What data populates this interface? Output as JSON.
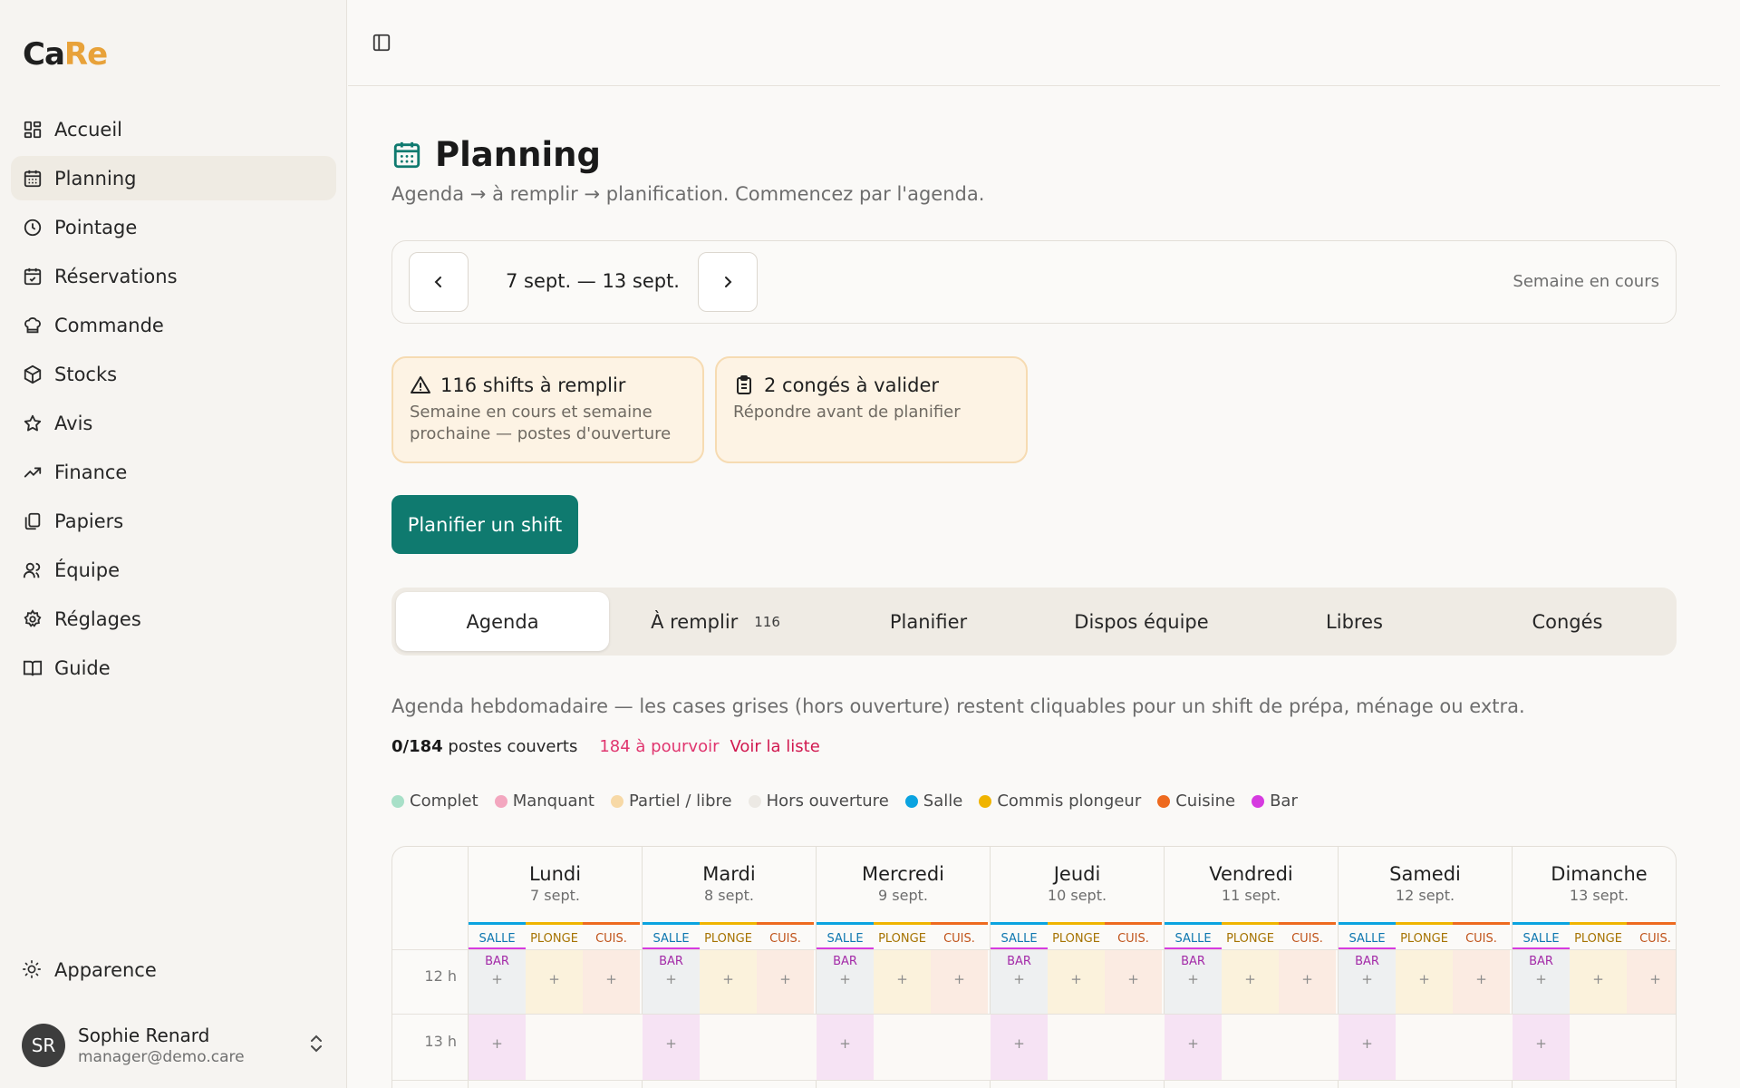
{
  "app": {
    "logo_ca": "Ca",
    "logo_re": "Re"
  },
  "sidebar": {
    "items": [
      {
        "label": "Accueil",
        "icon": "dashboard-icon"
      },
      {
        "label": "Planning",
        "icon": "calendar-icon",
        "active": true
      },
      {
        "label": "Pointage",
        "icon": "clock-icon"
      },
      {
        "label": "Réservations",
        "icon": "calendar-check-icon"
      },
      {
        "label": "Commande",
        "icon": "chef-hat-icon"
      },
      {
        "label": "Stocks",
        "icon": "package-icon"
      },
      {
        "label": "Avis",
        "icon": "star-icon"
      },
      {
        "label": "Finance",
        "icon": "trend-icon"
      },
      {
        "label": "Papiers",
        "icon": "documents-icon"
      },
      {
        "label": "Équipe",
        "icon": "users-icon"
      },
      {
        "label": "Réglages",
        "icon": "gear-icon"
      },
      {
        "label": "Guide",
        "icon": "book-icon"
      }
    ],
    "appearance": "Apparence",
    "user": {
      "initials": "SR",
      "name": "Sophie Renard",
      "email": "manager@demo.care"
    }
  },
  "page": {
    "title": "Planning",
    "subtitle": "Agenda → à remplir → planification. Commencez par l'agenda."
  },
  "week": {
    "range": "7 sept. — 13 sept.",
    "current": "Semaine en cours"
  },
  "alerts": [
    {
      "title": "116 shifts à remplir",
      "sub": "Semaine en cours et semaine prochaine — postes d'ouverture",
      "icon": "warning-icon"
    },
    {
      "title": "2 congés à valider",
      "sub": "Répondre avant de planifier",
      "icon": "clipboard-icon"
    }
  ],
  "plan_button": "Planifier un shift",
  "tabs": [
    {
      "label": "Agenda",
      "active": true
    },
    {
      "label": "À remplir",
      "count": "116"
    },
    {
      "label": "Planifier"
    },
    {
      "label": "Dispos équipe"
    },
    {
      "label": "Libres"
    },
    {
      "label": "Congés"
    }
  ],
  "agenda": {
    "description": "Agenda hebdomadaire — les cases grises (hors ouverture) restent cliquables pour un shift de prépa, ménage ou extra.",
    "covered_value": "0/184",
    "covered_label": "postes couverts",
    "open": "184 à pourvoir",
    "link": "Voir la liste"
  },
  "legend": [
    {
      "label": "Complet",
      "color": "#a8e0c8"
    },
    {
      "label": "Manquant",
      "color": "#f3a7bf"
    },
    {
      "label": "Partiel / libre",
      "color": "#f7d9a6"
    },
    {
      "label": "Hors ouverture",
      "color": "#ece9e4"
    },
    {
      "label": "Salle",
      "color": "#0aa3e0"
    },
    {
      "label": "Commis plongeur",
      "color": "#f0b400"
    },
    {
      "label": "Cuisine",
      "color": "#ee6a1f"
    },
    {
      "label": "Bar",
      "color": "#d63be0"
    }
  ],
  "calendar": {
    "hours": [
      "12 h",
      "13 h"
    ],
    "roles": [
      "SALLE",
      "PLONGE",
      "CUIS."
    ],
    "bar_label": "BAR",
    "plus": "+",
    "days": [
      {
        "name": "Lundi",
        "date": "7 sept."
      },
      {
        "name": "Mardi",
        "date": "8 sept."
      },
      {
        "name": "Mercredi",
        "date": "9 sept."
      },
      {
        "name": "Jeudi",
        "date": "10 sept."
      },
      {
        "name": "Vendredi",
        "date": "11 sept."
      },
      {
        "name": "Samedi",
        "date": "12 sept."
      },
      {
        "name": "Dimanche",
        "date": "13 sept."
      }
    ]
  }
}
